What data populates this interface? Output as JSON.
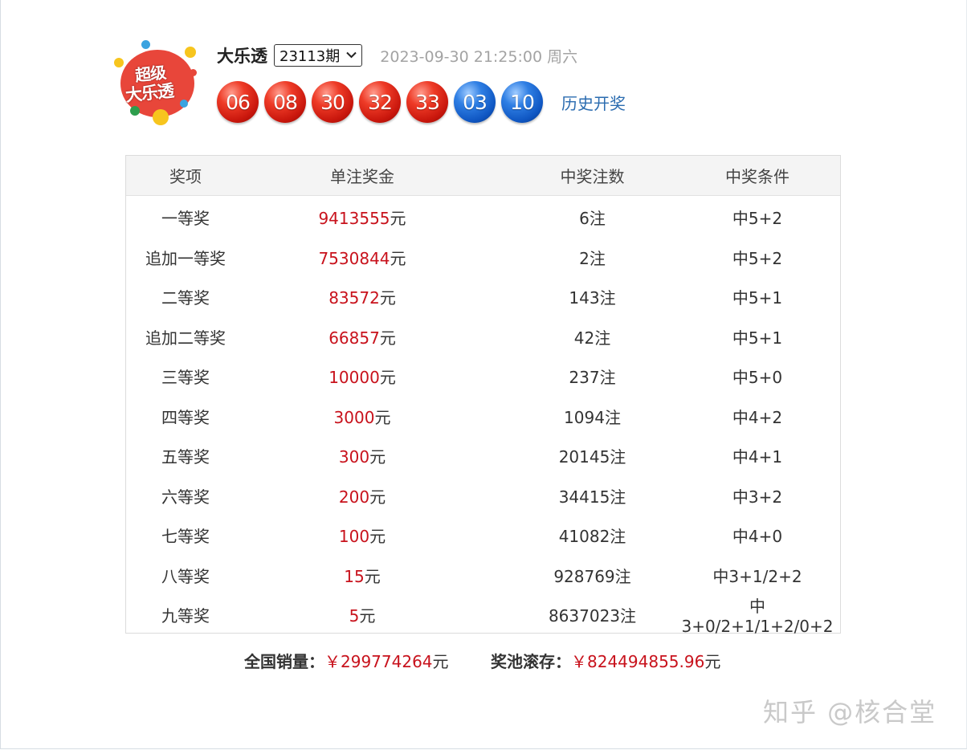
{
  "logo": {
    "line1": "超级",
    "line2": "大乐透"
  },
  "header": {
    "game_name": "大乐透",
    "issue": "23113期",
    "draw_time": "2023-09-30 21:25:00 周六"
  },
  "balls": {
    "front": [
      "06",
      "08",
      "30",
      "32",
      "33"
    ],
    "back": [
      "03",
      "10"
    ]
  },
  "history_link": "历史开奖",
  "table": {
    "headers": [
      "奖项",
      "单注奖金",
      "中奖注数",
      "中奖条件"
    ],
    "rows": [
      {
        "name": "一等奖",
        "amount": "9413555",
        "unit": "元",
        "count": "6注",
        "cond": "中5+2"
      },
      {
        "name": "追加一等奖",
        "amount": "7530844",
        "unit": "元",
        "count": "2注",
        "cond": "中5+2"
      },
      {
        "name": "二等奖",
        "amount": "83572",
        "unit": "元",
        "count": "143注",
        "cond": "中5+1"
      },
      {
        "name": "追加二等奖",
        "amount": "66857",
        "unit": "元",
        "count": "42注",
        "cond": "中5+1"
      },
      {
        "name": "三等奖",
        "amount": "10000",
        "unit": "元",
        "count": "237注",
        "cond": "中5+0"
      },
      {
        "name": "四等奖",
        "amount": "3000",
        "unit": "元",
        "count": "1094注",
        "cond": "中4+2"
      },
      {
        "name": "五等奖",
        "amount": "300",
        "unit": "元",
        "count": "20145注",
        "cond": "中4+1"
      },
      {
        "name": "六等奖",
        "amount": "200",
        "unit": "元",
        "count": "34415注",
        "cond": "中3+2"
      },
      {
        "name": "七等奖",
        "amount": "100",
        "unit": "元",
        "count": "41082注",
        "cond": "中4+0"
      },
      {
        "name": "八等奖",
        "amount": "15",
        "unit": "元",
        "count": "928769注",
        "cond": "中3+1/2+2"
      },
      {
        "name": "九等奖",
        "amount": "5",
        "unit": "元",
        "count": "8637023注",
        "cond": "中3+0/2+1/1+2/0+2"
      }
    ]
  },
  "summary": {
    "sales_label": "全国销量：",
    "sales_value": "￥299774264",
    "sales_unit": "元",
    "pool_label": "奖池滚存：",
    "pool_value": "￥824494855.96",
    "pool_unit": "元"
  },
  "watermark": "知乎 @核合堂"
}
